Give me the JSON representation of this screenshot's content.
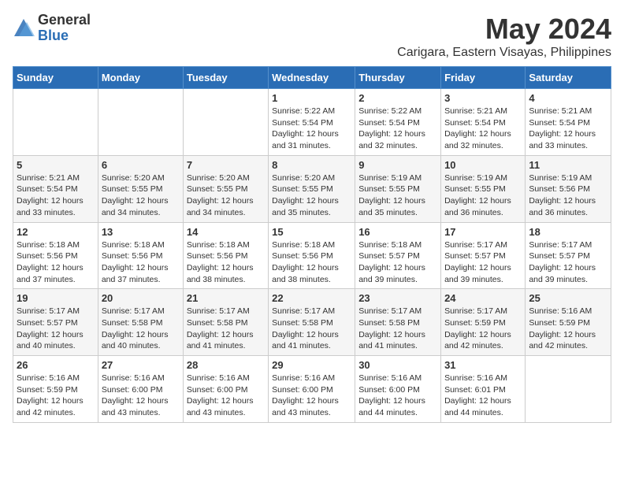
{
  "logo": {
    "general": "General",
    "blue": "Blue"
  },
  "title": "May 2024",
  "subtitle": "Carigara, Eastern Visayas, Philippines",
  "days_header": [
    "Sunday",
    "Monday",
    "Tuesday",
    "Wednesday",
    "Thursday",
    "Friday",
    "Saturday"
  ],
  "weeks": [
    [
      {
        "day": "",
        "info": ""
      },
      {
        "day": "",
        "info": ""
      },
      {
        "day": "",
        "info": ""
      },
      {
        "day": "1",
        "info": "Sunrise: 5:22 AM\nSunset: 5:54 PM\nDaylight: 12 hours\nand 31 minutes."
      },
      {
        "day": "2",
        "info": "Sunrise: 5:22 AM\nSunset: 5:54 PM\nDaylight: 12 hours\nand 32 minutes."
      },
      {
        "day": "3",
        "info": "Sunrise: 5:21 AM\nSunset: 5:54 PM\nDaylight: 12 hours\nand 32 minutes."
      },
      {
        "day": "4",
        "info": "Sunrise: 5:21 AM\nSunset: 5:54 PM\nDaylight: 12 hours\nand 33 minutes."
      }
    ],
    [
      {
        "day": "5",
        "info": "Sunrise: 5:21 AM\nSunset: 5:54 PM\nDaylight: 12 hours\nand 33 minutes."
      },
      {
        "day": "6",
        "info": "Sunrise: 5:20 AM\nSunset: 5:55 PM\nDaylight: 12 hours\nand 34 minutes."
      },
      {
        "day": "7",
        "info": "Sunrise: 5:20 AM\nSunset: 5:55 PM\nDaylight: 12 hours\nand 34 minutes."
      },
      {
        "day": "8",
        "info": "Sunrise: 5:20 AM\nSunset: 5:55 PM\nDaylight: 12 hours\nand 35 minutes."
      },
      {
        "day": "9",
        "info": "Sunrise: 5:19 AM\nSunset: 5:55 PM\nDaylight: 12 hours\nand 35 minutes."
      },
      {
        "day": "10",
        "info": "Sunrise: 5:19 AM\nSunset: 5:55 PM\nDaylight: 12 hours\nand 36 minutes."
      },
      {
        "day": "11",
        "info": "Sunrise: 5:19 AM\nSunset: 5:56 PM\nDaylight: 12 hours\nand 36 minutes."
      }
    ],
    [
      {
        "day": "12",
        "info": "Sunrise: 5:18 AM\nSunset: 5:56 PM\nDaylight: 12 hours\nand 37 minutes."
      },
      {
        "day": "13",
        "info": "Sunrise: 5:18 AM\nSunset: 5:56 PM\nDaylight: 12 hours\nand 37 minutes."
      },
      {
        "day": "14",
        "info": "Sunrise: 5:18 AM\nSunset: 5:56 PM\nDaylight: 12 hours\nand 38 minutes."
      },
      {
        "day": "15",
        "info": "Sunrise: 5:18 AM\nSunset: 5:56 PM\nDaylight: 12 hours\nand 38 minutes."
      },
      {
        "day": "16",
        "info": "Sunrise: 5:18 AM\nSunset: 5:57 PM\nDaylight: 12 hours\nand 39 minutes."
      },
      {
        "day": "17",
        "info": "Sunrise: 5:17 AM\nSunset: 5:57 PM\nDaylight: 12 hours\nand 39 minutes."
      },
      {
        "day": "18",
        "info": "Sunrise: 5:17 AM\nSunset: 5:57 PM\nDaylight: 12 hours\nand 39 minutes."
      }
    ],
    [
      {
        "day": "19",
        "info": "Sunrise: 5:17 AM\nSunset: 5:57 PM\nDaylight: 12 hours\nand 40 minutes."
      },
      {
        "day": "20",
        "info": "Sunrise: 5:17 AM\nSunset: 5:58 PM\nDaylight: 12 hours\nand 40 minutes."
      },
      {
        "day": "21",
        "info": "Sunrise: 5:17 AM\nSunset: 5:58 PM\nDaylight: 12 hours\nand 41 minutes."
      },
      {
        "day": "22",
        "info": "Sunrise: 5:17 AM\nSunset: 5:58 PM\nDaylight: 12 hours\nand 41 minutes."
      },
      {
        "day": "23",
        "info": "Sunrise: 5:17 AM\nSunset: 5:58 PM\nDaylight: 12 hours\nand 41 minutes."
      },
      {
        "day": "24",
        "info": "Sunrise: 5:17 AM\nSunset: 5:59 PM\nDaylight: 12 hours\nand 42 minutes."
      },
      {
        "day": "25",
        "info": "Sunrise: 5:16 AM\nSunset: 5:59 PM\nDaylight: 12 hours\nand 42 minutes."
      }
    ],
    [
      {
        "day": "26",
        "info": "Sunrise: 5:16 AM\nSunset: 5:59 PM\nDaylight: 12 hours\nand 42 minutes."
      },
      {
        "day": "27",
        "info": "Sunrise: 5:16 AM\nSunset: 6:00 PM\nDaylight: 12 hours\nand 43 minutes."
      },
      {
        "day": "28",
        "info": "Sunrise: 5:16 AM\nSunset: 6:00 PM\nDaylight: 12 hours\nand 43 minutes."
      },
      {
        "day": "29",
        "info": "Sunrise: 5:16 AM\nSunset: 6:00 PM\nDaylight: 12 hours\nand 43 minutes."
      },
      {
        "day": "30",
        "info": "Sunrise: 5:16 AM\nSunset: 6:00 PM\nDaylight: 12 hours\nand 44 minutes."
      },
      {
        "day": "31",
        "info": "Sunrise: 5:16 AM\nSunset: 6:01 PM\nDaylight: 12 hours\nand 44 minutes."
      },
      {
        "day": "",
        "info": ""
      }
    ]
  ]
}
